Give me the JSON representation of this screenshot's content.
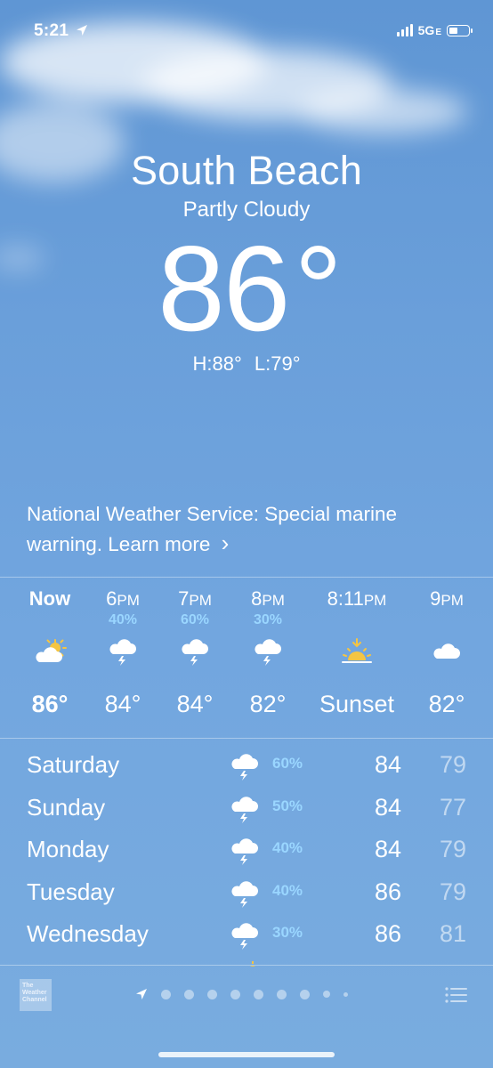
{
  "status_bar": {
    "time": "5:21",
    "network": "5G",
    "network_suffix": "E"
  },
  "location": "South Beach",
  "condition": "Partly Cloudy",
  "temperature": "86",
  "degree_symbol": "°",
  "high_low": "H:88°  L:79°",
  "alert": {
    "text": "National Weather Service: Special marine warning. Learn more",
    "chevron": "›"
  },
  "hourly": [
    {
      "time": "Now",
      "suffix": "",
      "pop": "",
      "icon": "partly-sunny-icon",
      "value": "86°"
    },
    {
      "time": "6",
      "suffix": "PM",
      "pop": "40%",
      "icon": "thunderstorm-icon",
      "value": "84°"
    },
    {
      "time": "7",
      "suffix": "PM",
      "pop": "60%",
      "icon": "thunderstorm-icon",
      "value": "84°"
    },
    {
      "time": "8",
      "suffix": "PM",
      "pop": "30%",
      "icon": "thunderstorm-icon",
      "value": "82°"
    },
    {
      "time": "8:11",
      "suffix": "PM",
      "pop": "",
      "icon": "sunset-icon",
      "value": "Sunset"
    },
    {
      "time": "9",
      "suffix": "PM",
      "pop": "",
      "icon": "cloud-icon",
      "value": "82°"
    }
  ],
  "daily": [
    {
      "day": "Saturday",
      "pop": "60%",
      "high": "84",
      "low": "79"
    },
    {
      "day": "Sunday",
      "pop": "50%",
      "high": "84",
      "low": "77"
    },
    {
      "day": "Monday",
      "pop": "40%",
      "high": "84",
      "low": "79"
    },
    {
      "day": "Tuesday",
      "pop": "40%",
      "high": "86",
      "low": "79"
    },
    {
      "day": "Wednesday",
      "pop": "30%",
      "high": "86",
      "low": "81"
    }
  ],
  "footer": {
    "logo_line1": "The",
    "logo_line2": "Weather",
    "logo_line3": "Channel"
  },
  "colors": {
    "pop_text": "#9ad6ff",
    "sun": "#f5c542"
  }
}
